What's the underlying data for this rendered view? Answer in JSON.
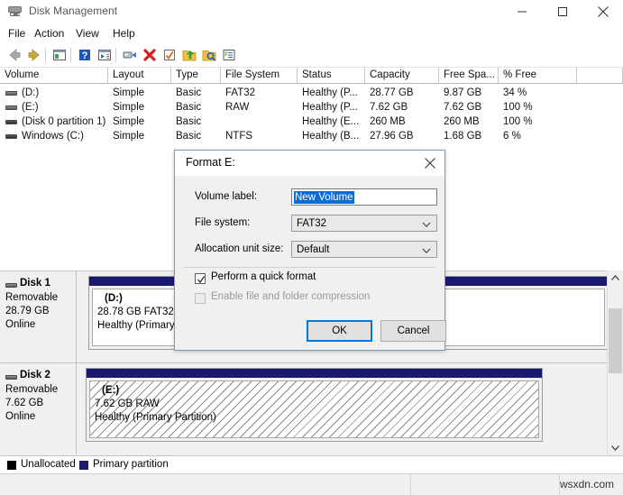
{
  "window": {
    "title": "Disk Management",
    "icon": "disk-drive-icon",
    "controls": {
      "minimize": "minimize-icon",
      "maximize": "maximize-icon",
      "close": "close-icon"
    }
  },
  "menubar": {
    "items": [
      "File",
      "Action",
      "View",
      "Help"
    ]
  },
  "toolbar": {
    "icons": [
      "back-arrow-icon",
      "forward-arrow-icon",
      "show-hide-console-tree-icon",
      "help-icon",
      "show-hide-action-pane-icon",
      "properties-icon",
      "delete-icon",
      "checkmark-icon",
      "export-list-icon",
      "search-icon",
      "details-view-icon"
    ]
  },
  "volume_list": {
    "columns": [
      "Volume",
      "Layout",
      "Type",
      "File System",
      "Status",
      "Capacity",
      "Free Spa...",
      "% Free"
    ],
    "rows": [
      {
        "volume": "(D:)",
        "layout": "Simple",
        "type": "Basic",
        "file_system": "FAT32",
        "status": "Healthy (P...",
        "capacity": "28.77 GB",
        "free_space": "9.87 GB",
        "percent_free": "34 %"
      },
      {
        "volume": "(E:)",
        "layout": "Simple",
        "type": "Basic",
        "file_system": "RAW",
        "status": "Healthy (P...",
        "capacity": "7.62 GB",
        "free_space": "7.62 GB",
        "percent_free": "100 %"
      },
      {
        "volume": "(Disk 0 partition 1)",
        "layout": "Simple",
        "type": "Basic",
        "file_system": "",
        "status": "Healthy (E...",
        "capacity": "260 MB",
        "free_space": "260 MB",
        "percent_free": "100 %"
      },
      {
        "volume": "Windows (C:)",
        "layout": "Simple",
        "type": "Basic",
        "file_system": "NTFS",
        "status": "Healthy (B...",
        "capacity": "27.96 GB",
        "free_space": "1.68 GB",
        "percent_free": "6 %"
      }
    ]
  },
  "disks": [
    {
      "name": "Disk 1",
      "media": "Removable",
      "size": "28.79 GB",
      "state": "Online",
      "partition": {
        "label": "(D:)",
        "size_fs": "28.78 GB FAT32",
        "status": "Healthy (Primary Pa",
        "style": "solid"
      }
    },
    {
      "name": "Disk 2",
      "media": "Removable",
      "size": "7.62 GB",
      "state": "Online",
      "partition": {
        "label": "(E:)",
        "size_fs": "7.62 GB RAW",
        "status": "Healthy (Primary Partition)",
        "style": "hatched"
      }
    }
  ],
  "legend": [
    {
      "label": "Unallocated",
      "color": "#000000"
    },
    {
      "label": "Primary partition",
      "color": "#191970"
    }
  ],
  "statusbar": {
    "watermark": "wsxdn.com"
  },
  "dialog": {
    "title": "Format E:",
    "close_icon": "close-icon",
    "fields": [
      {
        "label": "Volume label:",
        "value": "New Volume",
        "kind": "text"
      },
      {
        "label": "File system:",
        "value": "FAT32",
        "kind": "select"
      },
      {
        "label": "Allocation unit size:",
        "value": "Default",
        "kind": "select"
      }
    ],
    "checkboxes": [
      {
        "label": "Perform a quick format",
        "checked": true,
        "enabled": true
      },
      {
        "label": "Enable file and folder compression",
        "checked": false,
        "enabled": false
      }
    ],
    "buttons": {
      "ok": "OK",
      "cancel": "Cancel"
    }
  },
  "colors": {
    "primary_partition": "#191970",
    "selection": "#0b6cd4",
    "default_button_border": "#0078d7",
    "dialog_border": "#7a9cbf"
  }
}
